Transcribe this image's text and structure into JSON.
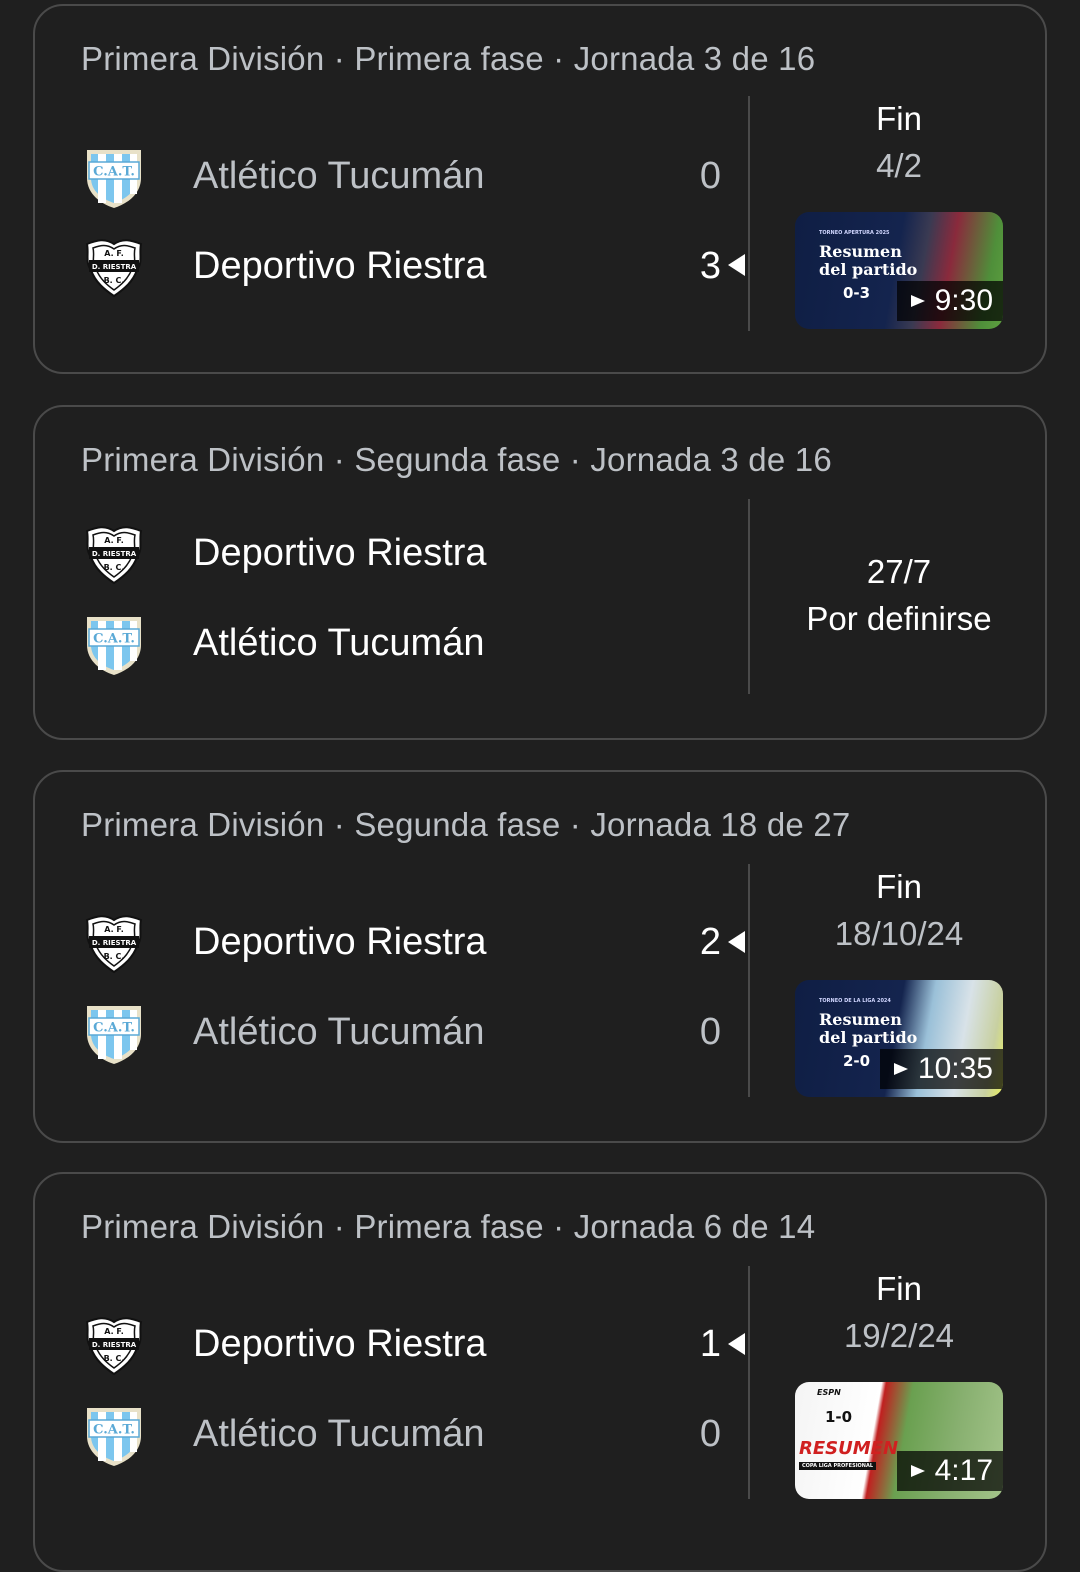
{
  "colors": {
    "background": "#1f1f1f",
    "card_border": "#4a4a4a",
    "text_primary": "#ffffff",
    "text_secondary": "#bdc1c6"
  },
  "matches": [
    {
      "header": "Primera División · Primera fase · Jornada 3 de 16",
      "teams": [
        {
          "name": "Atlético Tucumán",
          "score": "0",
          "crest": "cat-crest-icon",
          "winner": false
        },
        {
          "name": "Deportivo Riestra",
          "score": "3",
          "crest": "riestra-crest-icon",
          "winner": true
        }
      ],
      "status": "Fin",
      "date": "4/2",
      "video": {
        "duration": "9:30",
        "banner": "TORNEO APERTURA 2025",
        "title_line1": "Resumen",
        "title_line2": "del partido",
        "result": "0-3"
      }
    },
    {
      "header": "Primera División · Segunda fase · Jornada 3 de 16",
      "teams": [
        {
          "name": "Deportivo Riestra",
          "crest": "riestra-crest-icon"
        },
        {
          "name": "Atlético Tucumán",
          "crest": "cat-crest-icon"
        }
      ],
      "date": "27/7",
      "status": "Por definirse"
    },
    {
      "header": "Primera División · Segunda fase · Jornada 18 de 27",
      "teams": [
        {
          "name": "Deportivo Riestra",
          "score": "2",
          "crest": "riestra-crest-icon",
          "winner": true
        },
        {
          "name": "Atlético Tucumán",
          "score": "0",
          "crest": "cat-crest-icon",
          "winner": false
        }
      ],
      "status": "Fin",
      "date": "18/10/24",
      "video": {
        "duration": "10:35",
        "banner": "TORNEO DE LA LIGA 2024",
        "title_line1": "Resumen",
        "title_line2": "del partido",
        "result": "2-0"
      }
    },
    {
      "header": "Primera División · Primera fase · Jornada 6 de 14",
      "teams": [
        {
          "name": "Deportivo Riestra",
          "score": "1",
          "crest": "riestra-crest-icon",
          "winner": true
        },
        {
          "name": "Atlético Tucumán",
          "score": "0",
          "crest": "cat-crest-icon",
          "winner": false
        }
      ],
      "status": "Fin",
      "date": "19/2/24",
      "video": {
        "duration": "4:17",
        "banner": "ESPN",
        "title_line1": "RESUMEN",
        "title_line2": "COPA LIGA PROFESIONAL",
        "result": "1-0"
      }
    }
  ]
}
